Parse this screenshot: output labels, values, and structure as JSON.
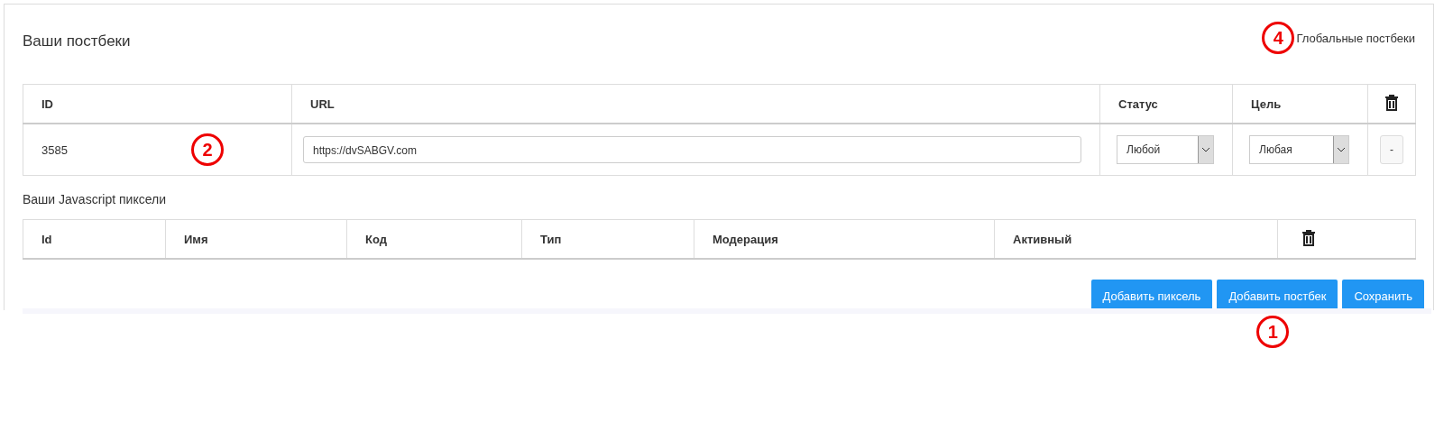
{
  "title": "Ваши постбеки",
  "global_link": {
    "label": "Глобальные постбеки",
    "annotation": "4"
  },
  "postbacks": {
    "columns": [
      "ID",
      "URL",
      "Статус",
      "Цель"
    ],
    "rows": [
      {
        "id": "3585",
        "annotation": "2",
        "url": "https://dvSABGV.com",
        "status": "Любой",
        "goal": "Любая",
        "remove": "-"
      }
    ]
  },
  "pixels_title": "Ваши Javascript пиксели",
  "pixels": {
    "columns": [
      "Id",
      "Имя",
      "Код",
      "Тип",
      "Модерация",
      "Активный"
    ]
  },
  "buttons": [
    {
      "label": "Добавить пиксель"
    },
    {
      "label": "Добавить постбек",
      "annotation": "1"
    },
    {
      "label": "Сохранить"
    }
  ]
}
